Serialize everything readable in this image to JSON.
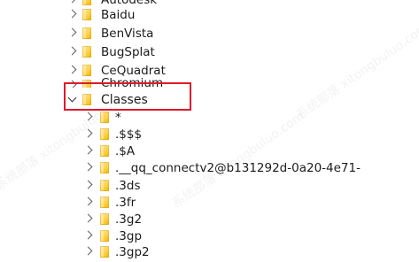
{
  "tree": {
    "items": [
      {
        "label": "Autodesk",
        "level": 0,
        "expanded": false
      },
      {
        "label": "Baidu",
        "level": 0,
        "expanded": false
      },
      {
        "label": "BenVista",
        "level": 0,
        "expanded": false
      },
      {
        "label": "BugSplat",
        "level": 0,
        "expanded": false
      },
      {
        "label": "CeQuadrat",
        "level": 0,
        "expanded": false
      },
      {
        "label": "Chromium",
        "level": 0,
        "expanded": false
      },
      {
        "label": "Classes",
        "level": 0,
        "expanded": true
      },
      {
        "label": "*",
        "level": 1,
        "expanded": false
      },
      {
        "label": ".$$$",
        "level": 1,
        "expanded": false
      },
      {
        "label": ".$A",
        "level": 1,
        "expanded": false
      },
      {
        "label": ".__qq_connectv2@b131292d-0a20-4e71-",
        "level": 1,
        "expanded": false
      },
      {
        "label": ".3ds",
        "level": 1,
        "expanded": false
      },
      {
        "label": ".3fr",
        "level": 1,
        "expanded": false
      },
      {
        "label": ".3g2",
        "level": 1,
        "expanded": false
      },
      {
        "label": ".3gp",
        "level": 1,
        "expanded": false
      },
      {
        "label": ".3gp2",
        "level": 1,
        "expanded": false
      }
    ]
  },
  "annotation": {
    "highlighted_item": "Classes",
    "color": "#e0192a"
  },
  "watermark": {
    "text": "系统部落 xitongbuluo.com"
  },
  "colors": {
    "folder": "#ffd24a",
    "text": "#1b1b1b"
  }
}
